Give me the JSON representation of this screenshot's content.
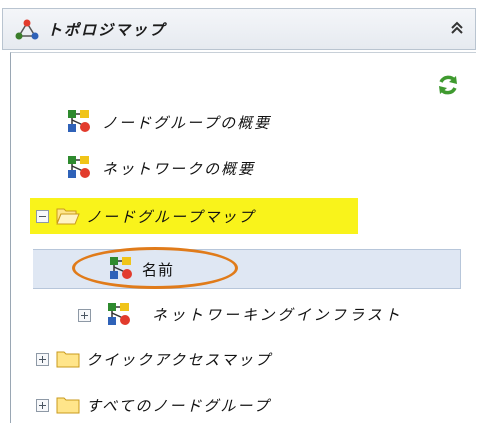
{
  "header": {
    "title": "トポロジマップ"
  },
  "tree": {
    "node_group_overview": "ノードグループの概要",
    "network_overview": "ネットワークの概要",
    "node_group_map": "ノードグループマップ",
    "name_item": "名前",
    "networking_infra": "ネットワーキングインフラスト",
    "quick_access_map": "クイックアクセスマップ",
    "all_node_groups": "すべてのノードグループ"
  },
  "colors": {
    "highlight": "#f9f31b",
    "annotation_oval": "#e07b1a",
    "selected_row": "#dfe7f3"
  }
}
